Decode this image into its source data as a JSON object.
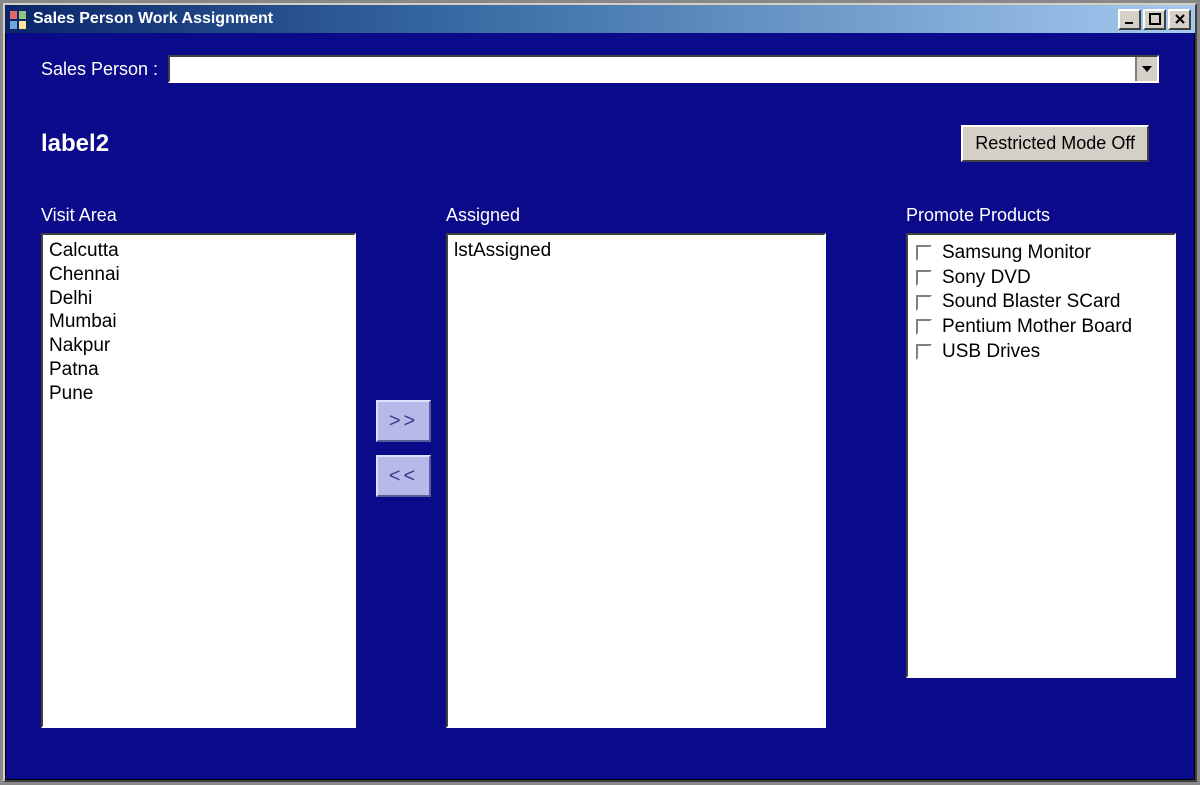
{
  "window": {
    "title": "Sales Person Work Assignment"
  },
  "labels": {
    "salesPerson": "Sales Person :",
    "label2": "label2",
    "visitArea": "Visit Area",
    "assigned": "Assigned",
    "promoteProducts": "Promote Products"
  },
  "combo": {
    "value": ""
  },
  "buttons": {
    "restricted": "Restricted Mode Off",
    "moveRight": ">>",
    "moveLeft": "<<"
  },
  "visitAreaItems": [
    "Calcutta",
    "Chennai",
    "Delhi",
    "Mumbai",
    "Nakpur",
    "Patna",
    "Pune"
  ],
  "assignedItems": [
    "lstAssigned"
  ],
  "promoteProducts": [
    {
      "label": "Samsung Monitor",
      "checked": false
    },
    {
      "label": "Sony DVD",
      "checked": false
    },
    {
      "label": "Sound Blaster SCard",
      "checked": false
    },
    {
      "label": "Pentium Mother Board",
      "checked": false
    },
    {
      "label": "USB Drives",
      "checked": false
    }
  ]
}
